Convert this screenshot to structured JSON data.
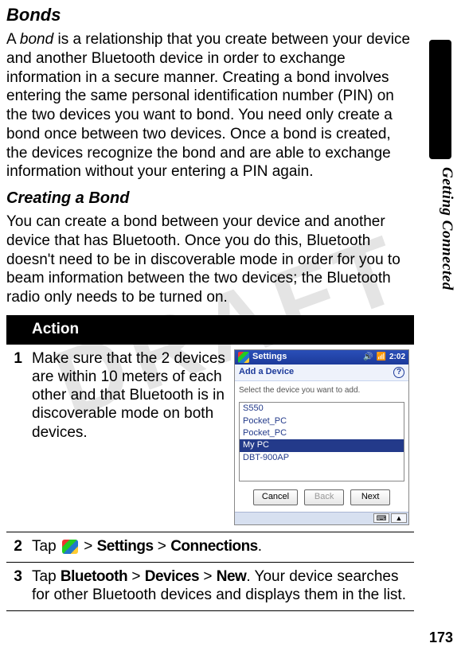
{
  "watermark": "DRAFT",
  "side_label": "Getting Connected",
  "page_number": "173",
  "headings": {
    "bonds": "Bonds",
    "creating": "Creating a Bond"
  },
  "paragraphs": {
    "p1_prefix": "A ",
    "p1_italic": "bond",
    "p1_suffix": " is a relationship that you create between your device and another Bluetooth device in order to exchange information in a secure manner. Creating a bond involves entering the same personal identification number (PIN) on the two devices you want to bond. You need only create a bond once between two devices. Once a bond is created, the devices recognize the bond and are able to exchange information without your entering a PIN again.",
    "p2": "You can create a bond between your device and another device that has Bluetooth. Once you do this, Bluetooth doesn't need to be in discoverable mode in order for you to beam information between the two devices; the Bluetooth radio only needs to be turned on."
  },
  "action": {
    "header": "Action",
    "steps": [
      {
        "num": "1",
        "text": "Make sure that the 2 devices are within 10 meters of each other and that Bluetooth is in discoverable mode on both devices."
      },
      {
        "num": "2",
        "pre": "Tap ",
        "parts_bold": [
          "Settings",
          "Connections"
        ],
        "seps": [
          " > ",
          " > ",
          "."
        ]
      },
      {
        "num": "3",
        "pre": "Tap ",
        "parts_bold": [
          "Bluetooth",
          "Devices",
          "New"
        ],
        "seps": [
          " > ",
          " > ",
          ". "
        ],
        "suffix": "Your device searches for other Bluetooth devices and displays them in the list."
      }
    ]
  },
  "screenshot": {
    "title": "Settings",
    "time": "2:02",
    "subbar": "Add a Device",
    "instruction": "Select the device you want to add.",
    "items": [
      "S550",
      "Pocket_PC",
      "Pocket_PC",
      "My PC",
      "DBT-900AP"
    ],
    "selected_index": 3,
    "buttons": {
      "cancel": "Cancel",
      "back": "Back",
      "next": "Next"
    },
    "status_icons": {
      "speaker": "🔊",
      "signal": "📶"
    }
  }
}
